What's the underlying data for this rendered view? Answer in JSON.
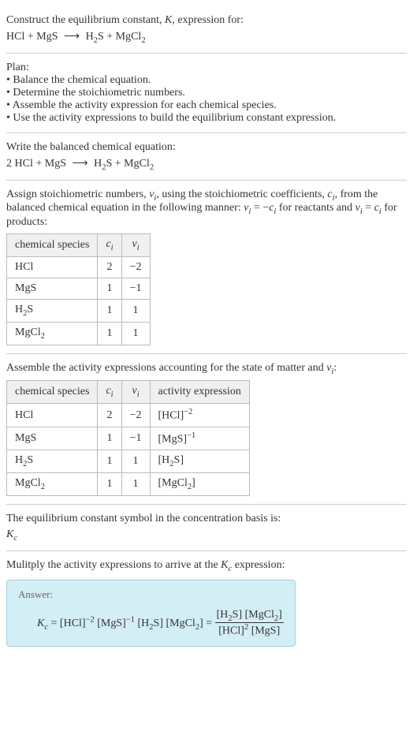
{
  "intro": {
    "line1_pre": "Construct the equilibrium constant, ",
    "line1_k": "K",
    "line1_post": ", expression for:",
    "equation_lhs1": "HCl",
    "equation_lhs2": "MgS",
    "equation_rhs1": "H",
    "equation_rhs1_sub": "2",
    "equation_rhs1b": "S",
    "equation_rhs2": "MgCl",
    "equation_rhs2_sub": "2"
  },
  "plan": {
    "header": "Plan:",
    "items": [
      "• Balance the chemical equation.",
      "• Determine the stoichiometric numbers.",
      "• Assemble the activity expression for each chemical species.",
      "• Use the activity expressions to build the equilibrium constant expression."
    ]
  },
  "balanced": {
    "header": "Write the balanced chemical equation:",
    "coef1": "2",
    "sp1": "HCl",
    "sp2": "MgS",
    "sp3a": "H",
    "sp3sub": "2",
    "sp3b": "S",
    "sp4a": "MgCl",
    "sp4sub": "2"
  },
  "assign": {
    "text1": "Assign stoichiometric numbers, ",
    "nu": "ν",
    "i": "i",
    "text2": ", using the stoichiometric coefficients, ",
    "c": "c",
    "text3": ", from the balanced chemical equation in the following manner: ",
    "eq1_lhs": "ν",
    "eq1_rhs_neg": " = −",
    "eq1_rhs_c": "c",
    "text4": " for reactants and ",
    "eq2_rhs_eq": " = ",
    "text5": " for products:",
    "table": {
      "headers": [
        "chemical species",
        "c",
        "ν"
      ],
      "rows": [
        {
          "species": "HCl",
          "species_sub": "",
          "c": "2",
          "nu": "−2"
        },
        {
          "species": "MgS",
          "species_sub": "",
          "c": "1",
          "nu": "−1"
        },
        {
          "species": "H",
          "species_sub": "2",
          "species2": "S",
          "c": "1",
          "nu": "1"
        },
        {
          "species": "MgCl",
          "species_sub": "2",
          "species2": "",
          "c": "1",
          "nu": "1"
        }
      ]
    }
  },
  "assemble": {
    "header_pre": "Assemble the activity expressions accounting for the state of matter and ",
    "nu": "ν",
    "i": "i",
    "header_post": ":",
    "table": {
      "headers": [
        "chemical species",
        "c",
        "ν",
        "activity expression"
      ],
      "rows": [
        {
          "sp": "HCl",
          "sp_sub": "",
          "sp2": "",
          "c": "2",
          "nu": "−2",
          "act": "[HCl]",
          "act_sup": "−2"
        },
        {
          "sp": "MgS",
          "sp_sub": "",
          "sp2": "",
          "c": "1",
          "nu": "−1",
          "act": "[MgS]",
          "act_sup": "−1"
        },
        {
          "sp": "H",
          "sp_sub": "2",
          "sp2": "S",
          "c": "1",
          "nu": "1",
          "act": "[H",
          "act_sub": "2",
          "act2": "S]",
          "act_sup": ""
        },
        {
          "sp": "MgCl",
          "sp_sub": "2",
          "sp2": "",
          "c": "1",
          "nu": "1",
          "act": "[MgCl",
          "act_sub": "2",
          "act2": "]",
          "act_sup": ""
        }
      ]
    }
  },
  "symbol": {
    "line1": "The equilibrium constant symbol in the concentration basis is:",
    "K": "K",
    "c": "c"
  },
  "multiply": {
    "text_pre": "Mulitply the activity expressions to arrive at the ",
    "K": "K",
    "c": "c",
    "text_post": " expression:"
  },
  "answer": {
    "label": "Answer:",
    "K": "K",
    "c": "c",
    "eq": " = ",
    "t1": "[HCl]",
    "t1_sup": "−2",
    "t2": " [MgS]",
    "t2_sup": "−1",
    "t3": " [H",
    "t3_sub": "2",
    "t3b": "S] [MgCl",
    "t3_sub2": "2",
    "t3c": "] = ",
    "num1": "[H",
    "num1_sub": "2",
    "num1b": "S] [MgCl",
    "num1_sub2": "2",
    "num1c": "]",
    "den1": "[HCl]",
    "den1_sup": "2",
    "den2": " [MgS]"
  }
}
